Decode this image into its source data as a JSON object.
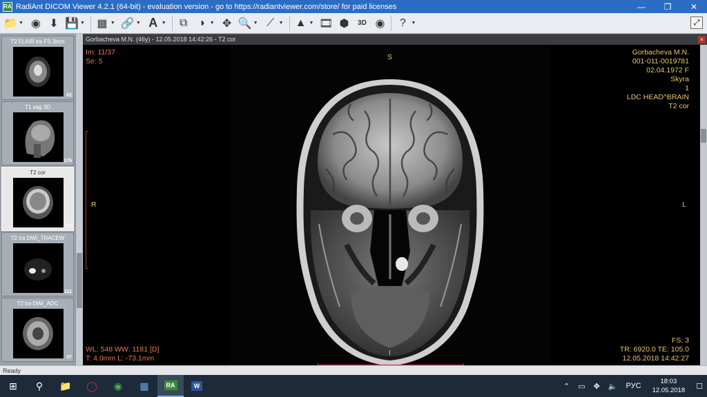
{
  "window": {
    "title": "RadiAnt DICOM Viewer 4.2.1 (64-bit) - evaluation version - go to https://radiantviewer.com/store/ for paid licenses",
    "app_icon": "RA"
  },
  "toolbar": {
    "icons": [
      "folder-icon",
      "disc-icon",
      "download-icon",
      "save-icon",
      "layout-grid-icon",
      "link-icon",
      "text-icon",
      "stack-icon",
      "windowing-icon",
      "pan-icon",
      "zoom-icon",
      "measure-icon",
      "volume-icon",
      "film-icon",
      "mpr-icon",
      "3d-icon",
      "fusion-icon",
      "help-icon"
    ],
    "fullscreen_glyph": "⤢"
  },
  "sidebar": {
    "series": [
      {
        "label": "T2 FLAIR tra FS 3mm",
        "count": "62"
      },
      {
        "label": "T1 sag 3D",
        "count": "176"
      },
      {
        "label": "T2 cor",
        "count": "37"
      },
      {
        "label": "T2 tra DWI_TRACEW",
        "count": "111"
      },
      {
        "label": "T2 tra DWI_ADC",
        "count": "37"
      }
    ]
  },
  "viewport": {
    "header": "Gorbacheva M.N. (46y) - 12.05.2018 14:42:26 - T2 cor",
    "close_glyph": "×",
    "overlay": {
      "top_left": [
        "Im: 11/37",
        "Se: 5"
      ],
      "top_right": [
        "Gorbacheva M.N.",
        "001-011-0019781",
        "02.04.1972 F",
        "Skyra",
        "1",
        "LDC HEAD^BRAIN",
        "T2 cor"
      ],
      "bottom_left": [
        "WL: 548 WW: 1181 [D]",
        "T: 4.0mm L: -73.1mm"
      ],
      "bottom_right": [
        "FS: 3",
        "TR: 6920.0 TE: 105.0",
        "12.05.2018 14:42:27"
      ],
      "orientation": {
        "top": "S",
        "bottom": "I",
        "left": "R",
        "right": "L"
      }
    }
  },
  "status": {
    "text": "Ready"
  },
  "taskbar": {
    "apps": [
      "windows-start-icon",
      "search-icon",
      "file-explorer-icon",
      "opera-icon",
      "chrome-icon",
      "paint-icon",
      "radiant-icon",
      "word-icon"
    ],
    "tray": {
      "language": "РУС",
      "time": "18:03",
      "date": "12.05.2018"
    }
  }
}
